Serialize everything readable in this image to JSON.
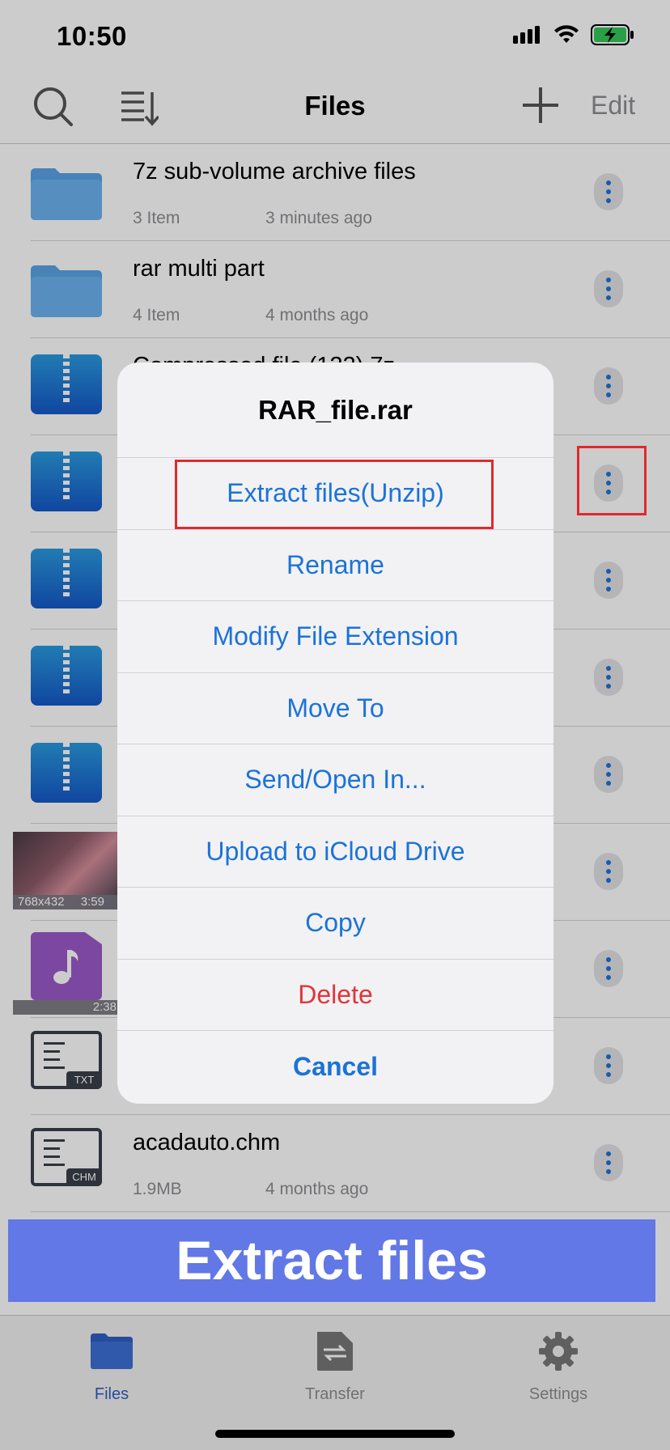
{
  "status_bar": {
    "time": "10:50"
  },
  "nav": {
    "title": "Files",
    "edit_label": "Edit"
  },
  "files": [
    {
      "name": "7z sub-volume archive files",
      "count": "3 Item",
      "date": "3 minutes ago",
      "type": "folder"
    },
    {
      "name": "rar multi part",
      "count": "4 Item",
      "date": "4 months ago",
      "type": "folder"
    },
    {
      "name": "Compressed file (122).7z",
      "count": "",
      "date": "",
      "type": "zip"
    },
    {
      "name": "",
      "count": "",
      "date": "",
      "type": "zip"
    },
    {
      "name": "",
      "count": "",
      "date": "",
      "type": "zip"
    },
    {
      "name": "",
      "count": "",
      "date": "",
      "type": "zip"
    },
    {
      "name": "",
      "count": "",
      "date": "",
      "type": "zip"
    },
    {
      "name": "",
      "count": "",
      "date": "",
      "type": "video",
      "thumb_label_left": "768x432",
      "thumb_label_right": "3:59"
    },
    {
      "name": "",
      "count": "",
      "date": "",
      "type": "audio",
      "thumb_label_right": "2:38"
    },
    {
      "name": "",
      "count": "",
      "date": "",
      "type": "doc",
      "ext": "TXT"
    },
    {
      "name": "acadauto.chm",
      "count": "1.9MB",
      "date": "4 months ago",
      "type": "doc",
      "ext": "CHM"
    }
  ],
  "action_sheet": {
    "title": "RAR_file.rar",
    "actions": [
      "Extract files(Unzip)",
      "Rename",
      "Modify File Extension",
      "Move To",
      "Send/Open In...",
      "Upload to iCloud Drive",
      "Copy",
      "Delete",
      "Cancel"
    ]
  },
  "banner": {
    "text": "Extract files"
  },
  "tabs": {
    "files": "Files",
    "transfer": "Transfer",
    "settings": "Settings"
  },
  "colors": {
    "accent": "#1b73d8",
    "danger": "#e0363a",
    "highlight": "#e0292e",
    "banner": "#6278e6",
    "tab_active": "#2f5fc4"
  }
}
